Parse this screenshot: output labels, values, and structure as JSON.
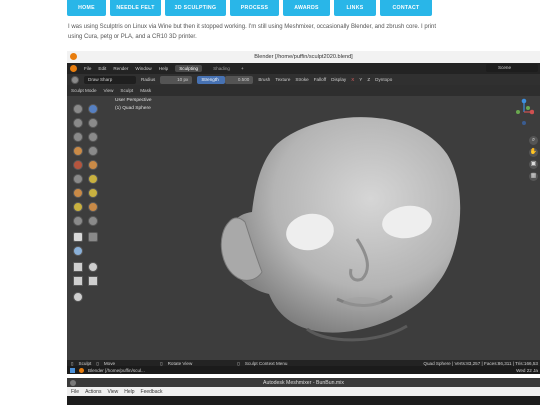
{
  "site_nav": {
    "items": [
      "HOME",
      "NEEDLE FELT",
      "3D SCULPTING",
      "PROCESS",
      "AWARDS",
      "LINKS",
      "CONTACT"
    ]
  },
  "intro": {
    "line1": "I was using Sculptris on Linux via Wine but then it stopped working. I'm still using Meshmixer, occasionally Blender, and zbrush core. I print",
    "line2": "using Cura, petg or PLA, and a CR10 3D printer."
  },
  "blender": {
    "title": "Blender [/home/puffin/sculpt2020.blend]",
    "menu": [
      "File",
      "Edit",
      "Render",
      "Window",
      "Help"
    ],
    "workspaces": [
      "Sculpting",
      "Shading"
    ],
    "add_tab": "+",
    "scene": "Scene",
    "toolbar": {
      "brush_name": "Draw Sharp",
      "radius_label": "Radius",
      "radius_value": "10 px",
      "strength_label": "Strength",
      "strength_value": "0.500",
      "menus": [
        "Brush",
        "Texture",
        "Stroke",
        "Falloff",
        "Display"
      ],
      "axes": [
        "X",
        "Y",
        "Z"
      ],
      "dyntopo": "Dyntopo"
    },
    "header": {
      "mode": "Sculpt Mode",
      "menus": [
        "View",
        "Sculpt",
        "Mask"
      ]
    },
    "viewport": {
      "perspective": "User Perspective",
      "object": "(1) Quad Sphere"
    },
    "status": {
      "sculpt": "Sculpt",
      "move": "Move",
      "rotate": "Rotate View",
      "context": "Sculpt Context Menu",
      "stats": "Quad Sphere | Verts:83,257 | Faces:86,311 | Tris:166,53"
    },
    "taskbar": {
      "window": "Blender [/home/puffin/scul...",
      "date": "Wed 22 Ja"
    }
  },
  "meshmixer": {
    "title": "Autodesk Meshmixer - BunBun.mix",
    "menu": [
      "File",
      "Actions",
      "View",
      "Help",
      "Feedback"
    ]
  }
}
